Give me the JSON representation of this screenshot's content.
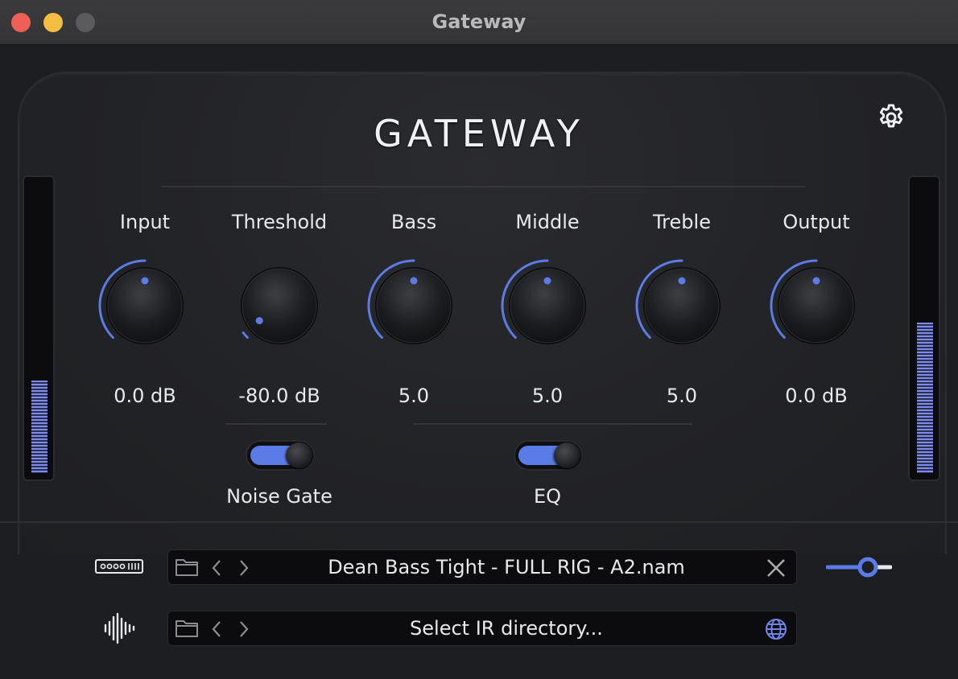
{
  "window": {
    "title": "Gateway"
  },
  "header": {
    "logo": "GATEWAY",
    "settings_icon": "gear-icon"
  },
  "meters": {
    "input_level": 0.32,
    "output_level": 0.52,
    "accent": "#7e8ce8"
  },
  "knobs": [
    {
      "id": "input",
      "label": "Input",
      "value": "0.0 dB"
    },
    {
      "id": "threshold",
      "label": "Threshold",
      "value": "-80.0 dB"
    },
    {
      "id": "bass",
      "label": "Bass",
      "value": "5.0"
    },
    {
      "id": "middle",
      "label": "Middle",
      "value": "5.0"
    },
    {
      "id": "treble",
      "label": "Treble",
      "value": "5.0"
    },
    {
      "id": "output",
      "label": "Output",
      "value": "0.0 dB"
    }
  ],
  "knob_positions": [
    0.5,
    0.03,
    0.5,
    0.5,
    0.5,
    0.5
  ],
  "toggles": {
    "noise_gate": {
      "label": "Noise Gate",
      "on": true
    },
    "eq": {
      "label": "EQ",
      "on": true
    }
  },
  "model_row": {
    "file": "Dean Bass Tight - FULL RIG - A2.nam",
    "leading_icon": "amp-model-icon",
    "trailing_icon": "close-icon"
  },
  "ir_row": {
    "file": "Select IR directory...",
    "leading_icon": "waveform-icon",
    "trailing_icon": "globe-icon"
  },
  "colors": {
    "accent": "#5b7ce6",
    "text": "#e8e9ec"
  }
}
